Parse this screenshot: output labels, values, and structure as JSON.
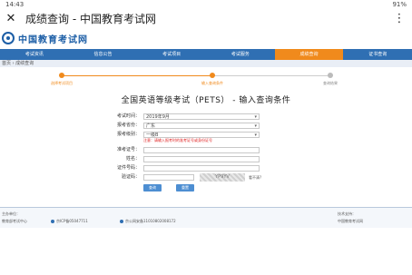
{
  "statusbar": {
    "time": "14:43",
    "signal": "闘",
    "right_text": "91%"
  },
  "titlebar": {
    "title": "成绩查询 - 中国教育考试网"
  },
  "logo": {
    "text": "中国教育考试网"
  },
  "nav": {
    "items": [
      "考试资讯",
      "信息公告",
      "考试项目",
      "考试服务",
      "成绩查询",
      "证书查询"
    ],
    "active_index": 4
  },
  "breadcrumb": "首页 › 成绩查询",
  "steps": {
    "labels": [
      "选择考试项目",
      "输入查询条件",
      "查询结果"
    ]
  },
  "form": {
    "heading": "全国英语等级考试（PETS） - 输入查询条件",
    "exam_time": {
      "label": "考试时间：",
      "value": "2019年9月"
    },
    "province": {
      "label": "报考省份：",
      "value": "广东"
    },
    "level": {
      "label": "报考级别：",
      "value": "一级B"
    },
    "notice": "注意：请输入报考时的准考证号或身份证号",
    "ticket": {
      "label": "准考证号：",
      "value": ""
    },
    "name": {
      "label": "姓名：",
      "value": ""
    },
    "id": {
      "label": "证件号码：",
      "value": ""
    },
    "captcha": {
      "label": "验证码：",
      "value": "",
      "image_text": "YP9YV",
      "refresh": "看不清?"
    },
    "submit": "查询",
    "reset": "重置"
  },
  "footer": {
    "left1": "主办单位：",
    "left2": "教育部考试中心",
    "mid1": "京ICP备05047711",
    "mid2": "京公网安备11010802008172",
    "right1": "技术支持：",
    "right2": "中国教育考试网"
  }
}
